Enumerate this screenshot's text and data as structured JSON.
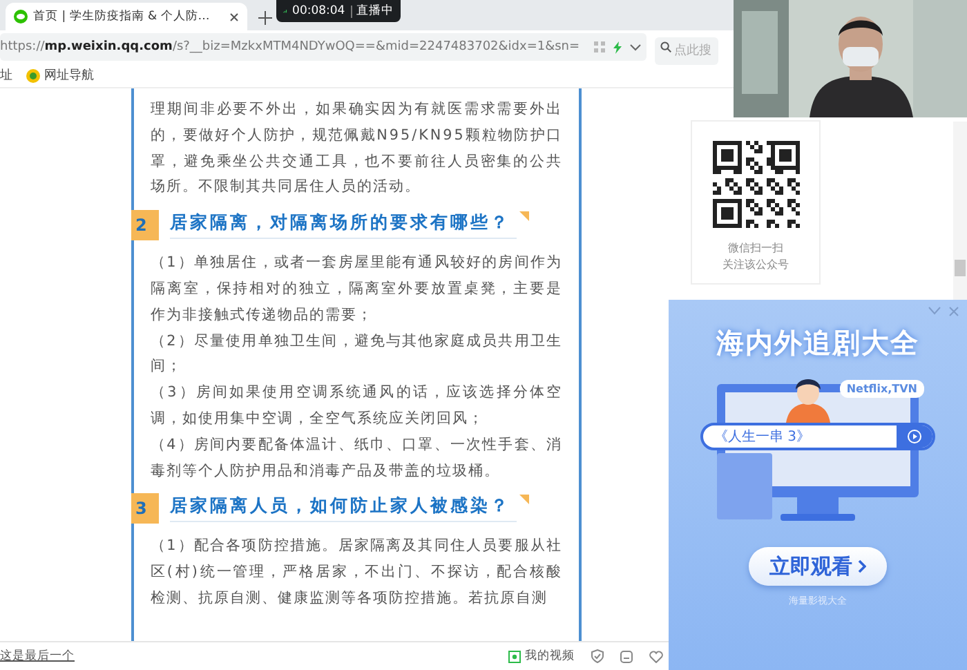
{
  "tabs": [
    {
      "label": "首页 | 学生防疫指南 & 个人防…",
      "selected": true
    }
  ],
  "live_indicator": {
    "time": "00:08:04",
    "status": "直播中"
  },
  "address_bar": {
    "url_host": "https://mp.weixin.qq.com",
    "url_path": "/s?__biz=MzkxMTM4NDYwOQ==&mid=2247483702&idx=1&sn="
  },
  "search": {
    "placeholder": "点此搜"
  },
  "bookmarks": [
    {
      "label": "址",
      "icon": false
    },
    {
      "label": "网址导航",
      "icon": true
    }
  ],
  "article": {
    "blocks": [
      {
        "kind": "paragraph",
        "text": "理期间非必要不外出，如果确实因为有就医需求需要外出的，要做好个人防护，规范佩戴N95/KN95颗粒物防护口罩，避免乘坐公共交通工具，也不要前往人员密集的公共场所。不限制其共同居住人员的活动。"
      },
      {
        "kind": "heading",
        "number": "2",
        "text": "居家隔离，对隔离场所的要求有哪些？"
      },
      {
        "kind": "paragraph",
        "text": "（1）单独居住，或者一套房屋里能有通风较好的房间作为隔离室，保持相对的独立，隔离室外要放置桌凳，主要是作为非接触式传递物品的需要；"
      },
      {
        "kind": "paragraph",
        "text": "（2）尽量使用单独卫生间，避免与其他家庭成员共用卫生间；"
      },
      {
        "kind": "paragraph",
        "text": "（3）房间如果使用空调系统通风的话，应该选择分体空调，如使用集中空调，全空气系统应关闭回风；"
      },
      {
        "kind": "paragraph",
        "text": "（4）房间内要配备体温计、纸巾、口罩、一次性手套、消毒剂等个人防护用品和消毒产品及带盖的垃圾桶。"
      },
      {
        "kind": "heading",
        "number": "3",
        "text": "居家隔离人员，如何防止家人被感染？"
      },
      {
        "kind": "paragraph",
        "text": "（1）配合各项防控措施。居家隔离及其同住人员要服从社区(村)统一管理，严格居家，不出门、不探访，配合核酸检测、抗原自测、健康监测等各项防控措施。若抗原自测"
      }
    ]
  },
  "qr_card": {
    "lines": [
      "微信扫一扫",
      "关注该公众号"
    ]
  },
  "ad": {
    "title": "海内外追剧大全",
    "bubble": "Netflix,TVN",
    "search_text": "《人生一串 3》",
    "button": "立即观看",
    "caption": "海量影视大全"
  },
  "status_bar": {
    "left": "这是最后一个",
    "video_label": "我的视频"
  }
}
